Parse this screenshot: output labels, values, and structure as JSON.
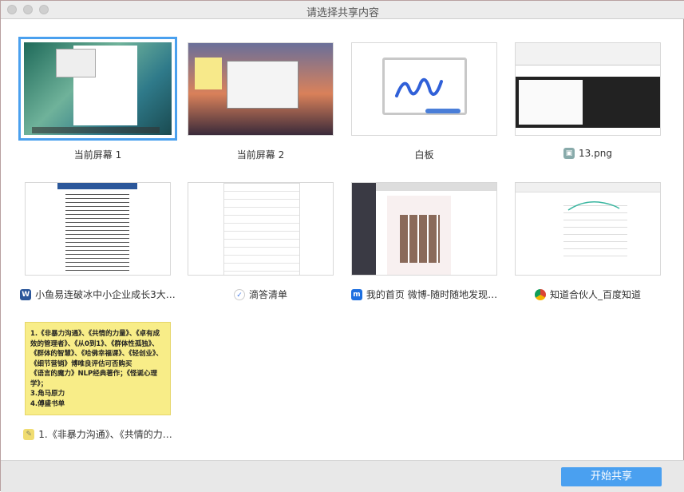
{
  "window": {
    "title": "请选择共享内容"
  },
  "items": [
    {
      "label": "当前屏幕 1",
      "icon": "none",
      "selected": true
    },
    {
      "label": "当前屏幕 2",
      "icon": "none"
    },
    {
      "label": "白板",
      "icon": "none"
    },
    {
      "label": "13.png",
      "icon": "image-file-icon"
    },
    {
      "label": "小鱼易连破冰中小企业成长3大…",
      "icon": "word-icon"
    },
    {
      "label": "滴答清单",
      "icon": "ticktick-icon"
    },
    {
      "label": "我的首页 微博-随时随地发现…",
      "icon": "browser-icon"
    },
    {
      "label": "知道合伙人_百度知道",
      "icon": "chrome-icon"
    },
    {
      "label": "1.《非暴力沟通》、《共情的力…",
      "icon": "stickies-icon"
    }
  ],
  "note_lines": [
    "1.《非暴力沟通》、《共情的力量》、《卓有成效的管理者》、《从0到1》、《群体性孤独》、《群体的智慧》、《哈佛幸福课》、《轻创业》、《细节营销》博唯良评估可否购买",
    "《语言的魔力》NLP经典著作；《怪诞心理学》；",
    "3.角马原力",
    "4.傅盛书单"
  ],
  "footer": {
    "start_share": "开始共享"
  },
  "colors": {
    "accent": "#4aa0f0",
    "note": "#f8ed88"
  }
}
